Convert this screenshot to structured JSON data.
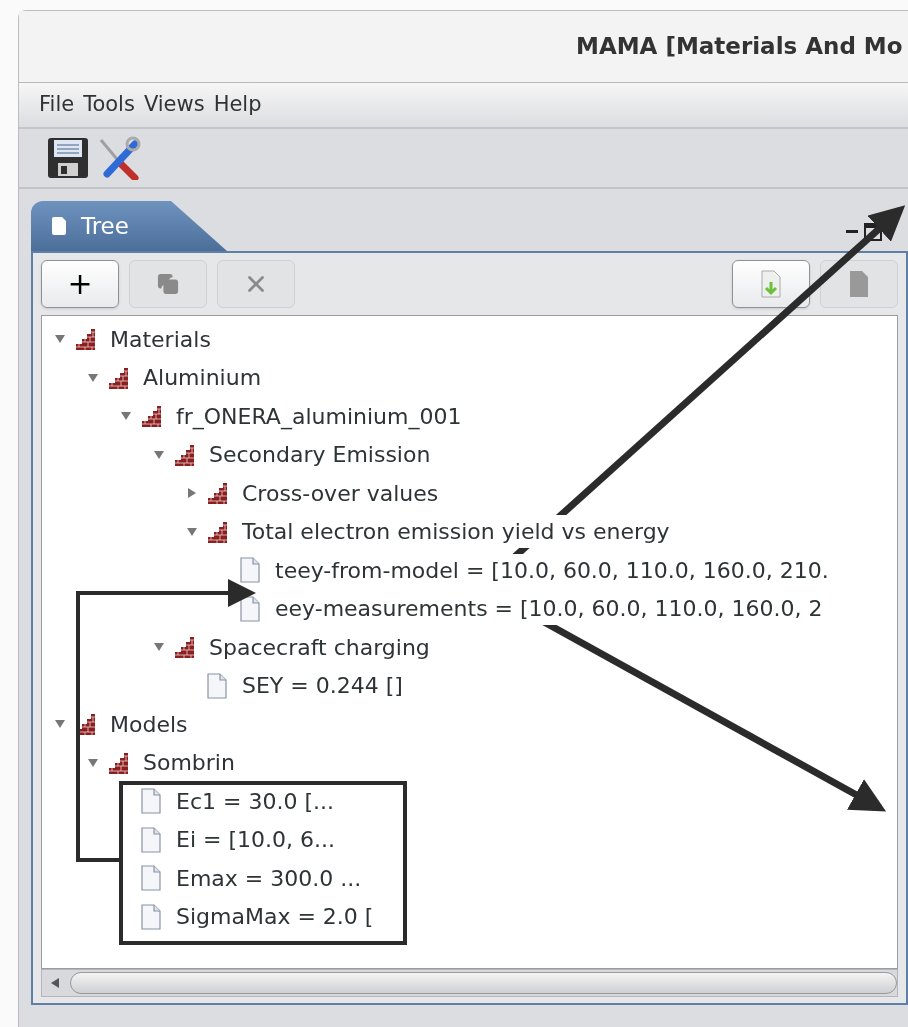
{
  "window": {
    "title": "MAMA [Materials And Mo"
  },
  "menu": [
    "File",
    "Tools",
    "Views",
    "Help"
  ],
  "toolbar": [
    {
      "kind": "save"
    },
    {
      "kind": "tools"
    }
  ],
  "tab": {
    "label": "Tree",
    "selected": true
  },
  "tree_buttons": [
    {
      "kind": "add",
      "label": "+",
      "disabled": false
    },
    {
      "kind": "copy",
      "disabled": true
    },
    {
      "kind": "delete",
      "disabled": true
    },
    {
      "kind": "import",
      "disabled": false
    },
    {
      "kind": "export",
      "disabled": true
    }
  ],
  "tree": [
    {
      "label": "Materials",
      "kind": "folder",
      "expanded": true,
      "children": [
        {
          "label": "Aluminium",
          "kind": "folder",
          "expanded": true,
          "children": [
            {
              "label": "fr_ONERA_aluminium_001",
              "kind": "folder",
              "expanded": true,
              "children": [
                {
                  "label": "Secondary Emission",
                  "kind": "folder",
                  "expanded": true,
                  "children": [
                    {
                      "label": "Cross-over values",
                      "kind": "folder",
                      "expanded": false
                    },
                    {
                      "label": "Total electron emission yield vs energy",
                      "kind": "folder",
                      "expanded": true,
                      "children": [
                        {
                          "label": "teey-from-model = [10.0, 60.0, 110.0, 160.0, 210.",
                          "kind": "leaf"
                        },
                        {
                          "label": "eey-measurements = [10.0, 60.0, 110.0, 160.0, 2",
                          "kind": "leaf"
                        }
                      ]
                    }
                  ]
                },
                {
                  "label": "Spacecraft charging",
                  "kind": "folder",
                  "expanded": true,
                  "children": [
                    {
                      "label": "SEY = 0.244 []",
                      "kind": "leaf"
                    }
                  ]
                }
              ]
            }
          ]
        }
      ]
    },
    {
      "label": "Models",
      "kind": "folder",
      "expanded": true,
      "children": [
        {
          "label": "Sombrin",
          "kind": "folder",
          "expanded": true,
          "children": [
            {
              "label": "Ec1 = 30.0 [...",
              "kind": "leaf"
            },
            {
              "label": "Ei = [10.0, 6...",
              "kind": "leaf"
            },
            {
              "label": "Emax = 300.0 ...",
              "kind": "leaf"
            },
            {
              "label": "SigmaMax = 2.0 [",
              "kind": "leaf"
            }
          ]
        }
      ]
    }
  ]
}
